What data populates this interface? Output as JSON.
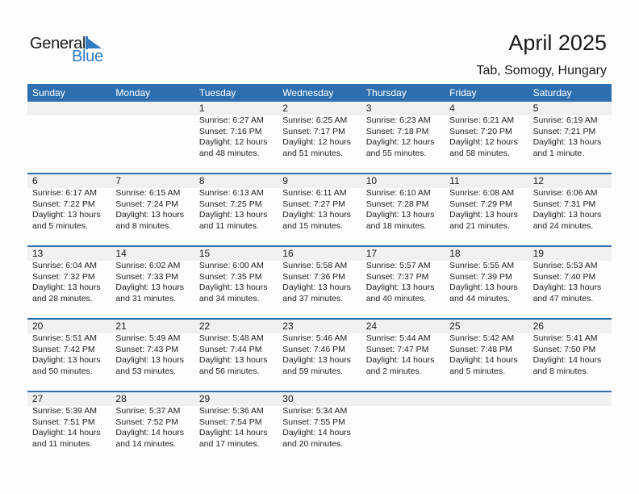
{
  "logo": {
    "general": "General",
    "blue": "Blue",
    "accent_color": "#2f7bc4"
  },
  "header": {
    "title": "April 2025",
    "location": "Tab, Somogy, Hungary"
  },
  "colors": {
    "header_bg": "#2e6fb0",
    "day_band": "#f0f0f0"
  },
  "weekdays": [
    "Sunday",
    "Monday",
    "Tuesday",
    "Wednesday",
    "Thursday",
    "Friday",
    "Saturday"
  ],
  "weeks": [
    [
      null,
      null,
      {
        "day": "1",
        "sunrise": "Sunrise: 6:27 AM",
        "sunset": "Sunset: 7:16 PM",
        "daylight1": "Daylight: 12 hours",
        "daylight2": "and 48 minutes."
      },
      {
        "day": "2",
        "sunrise": "Sunrise: 6:25 AM",
        "sunset": "Sunset: 7:17 PM",
        "daylight1": "Daylight: 12 hours",
        "daylight2": "and 51 minutes."
      },
      {
        "day": "3",
        "sunrise": "Sunrise: 6:23 AM",
        "sunset": "Sunset: 7:18 PM",
        "daylight1": "Daylight: 12 hours",
        "daylight2": "and 55 minutes."
      },
      {
        "day": "4",
        "sunrise": "Sunrise: 6:21 AM",
        "sunset": "Sunset: 7:20 PM",
        "daylight1": "Daylight: 12 hours",
        "daylight2": "and 58 minutes."
      },
      {
        "day": "5",
        "sunrise": "Sunrise: 6:19 AM",
        "sunset": "Sunset: 7:21 PM",
        "daylight1": "Daylight: 13 hours",
        "daylight2": "and 1 minute."
      }
    ],
    [
      {
        "day": "6",
        "sunrise": "Sunrise: 6:17 AM",
        "sunset": "Sunset: 7:22 PM",
        "daylight1": "Daylight: 13 hours",
        "daylight2": "and 5 minutes."
      },
      {
        "day": "7",
        "sunrise": "Sunrise: 6:15 AM",
        "sunset": "Sunset: 7:24 PM",
        "daylight1": "Daylight: 13 hours",
        "daylight2": "and 8 minutes."
      },
      {
        "day": "8",
        "sunrise": "Sunrise: 6:13 AM",
        "sunset": "Sunset: 7:25 PM",
        "daylight1": "Daylight: 13 hours",
        "daylight2": "and 11 minutes."
      },
      {
        "day": "9",
        "sunrise": "Sunrise: 6:11 AM",
        "sunset": "Sunset: 7:27 PM",
        "daylight1": "Daylight: 13 hours",
        "daylight2": "and 15 minutes."
      },
      {
        "day": "10",
        "sunrise": "Sunrise: 6:10 AM",
        "sunset": "Sunset: 7:28 PM",
        "daylight1": "Daylight: 13 hours",
        "daylight2": "and 18 minutes."
      },
      {
        "day": "11",
        "sunrise": "Sunrise: 6:08 AM",
        "sunset": "Sunset: 7:29 PM",
        "daylight1": "Daylight: 13 hours",
        "daylight2": "and 21 minutes."
      },
      {
        "day": "12",
        "sunrise": "Sunrise: 6:06 AM",
        "sunset": "Sunset: 7:31 PM",
        "daylight1": "Daylight: 13 hours",
        "daylight2": "and 24 minutes."
      }
    ],
    [
      {
        "day": "13",
        "sunrise": "Sunrise: 6:04 AM",
        "sunset": "Sunset: 7:32 PM",
        "daylight1": "Daylight: 13 hours",
        "daylight2": "and 28 minutes."
      },
      {
        "day": "14",
        "sunrise": "Sunrise: 6:02 AM",
        "sunset": "Sunset: 7:33 PM",
        "daylight1": "Daylight: 13 hours",
        "daylight2": "and 31 minutes."
      },
      {
        "day": "15",
        "sunrise": "Sunrise: 6:00 AM",
        "sunset": "Sunset: 7:35 PM",
        "daylight1": "Daylight: 13 hours",
        "daylight2": "and 34 minutes."
      },
      {
        "day": "16",
        "sunrise": "Sunrise: 5:58 AM",
        "sunset": "Sunset: 7:36 PM",
        "daylight1": "Daylight: 13 hours",
        "daylight2": "and 37 minutes."
      },
      {
        "day": "17",
        "sunrise": "Sunrise: 5:57 AM",
        "sunset": "Sunset: 7:37 PM",
        "daylight1": "Daylight: 13 hours",
        "daylight2": "and 40 minutes."
      },
      {
        "day": "18",
        "sunrise": "Sunrise: 5:55 AM",
        "sunset": "Sunset: 7:39 PM",
        "daylight1": "Daylight: 13 hours",
        "daylight2": "and 44 minutes."
      },
      {
        "day": "19",
        "sunrise": "Sunrise: 5:53 AM",
        "sunset": "Sunset: 7:40 PM",
        "daylight1": "Daylight: 13 hours",
        "daylight2": "and 47 minutes."
      }
    ],
    [
      {
        "day": "20",
        "sunrise": "Sunrise: 5:51 AM",
        "sunset": "Sunset: 7:42 PM",
        "daylight1": "Daylight: 13 hours",
        "daylight2": "and 50 minutes."
      },
      {
        "day": "21",
        "sunrise": "Sunrise: 5:49 AM",
        "sunset": "Sunset: 7:43 PM",
        "daylight1": "Daylight: 13 hours",
        "daylight2": "and 53 minutes."
      },
      {
        "day": "22",
        "sunrise": "Sunrise: 5:48 AM",
        "sunset": "Sunset: 7:44 PM",
        "daylight1": "Daylight: 13 hours",
        "daylight2": "and 56 minutes."
      },
      {
        "day": "23",
        "sunrise": "Sunrise: 5:46 AM",
        "sunset": "Sunset: 7:46 PM",
        "daylight1": "Daylight: 13 hours",
        "daylight2": "and 59 minutes."
      },
      {
        "day": "24",
        "sunrise": "Sunrise: 5:44 AM",
        "sunset": "Sunset: 7:47 PM",
        "daylight1": "Daylight: 14 hours",
        "daylight2": "and 2 minutes."
      },
      {
        "day": "25",
        "sunrise": "Sunrise: 5:42 AM",
        "sunset": "Sunset: 7:48 PM",
        "daylight1": "Daylight: 14 hours",
        "daylight2": "and 5 minutes."
      },
      {
        "day": "26",
        "sunrise": "Sunrise: 5:41 AM",
        "sunset": "Sunset: 7:50 PM",
        "daylight1": "Daylight: 14 hours",
        "daylight2": "and 8 minutes."
      }
    ],
    [
      {
        "day": "27",
        "sunrise": "Sunrise: 5:39 AM",
        "sunset": "Sunset: 7:51 PM",
        "daylight1": "Daylight: 14 hours",
        "daylight2": "and 11 minutes."
      },
      {
        "day": "28",
        "sunrise": "Sunrise: 5:37 AM",
        "sunset": "Sunset: 7:52 PM",
        "daylight1": "Daylight: 14 hours",
        "daylight2": "and 14 minutes."
      },
      {
        "day": "29",
        "sunrise": "Sunrise: 5:36 AM",
        "sunset": "Sunset: 7:54 PM",
        "daylight1": "Daylight: 14 hours",
        "daylight2": "and 17 minutes."
      },
      {
        "day": "30",
        "sunrise": "Sunrise: 5:34 AM",
        "sunset": "Sunset: 7:55 PM",
        "daylight1": "Daylight: 14 hours",
        "daylight2": "and 20 minutes."
      },
      null,
      null,
      null
    ]
  ]
}
